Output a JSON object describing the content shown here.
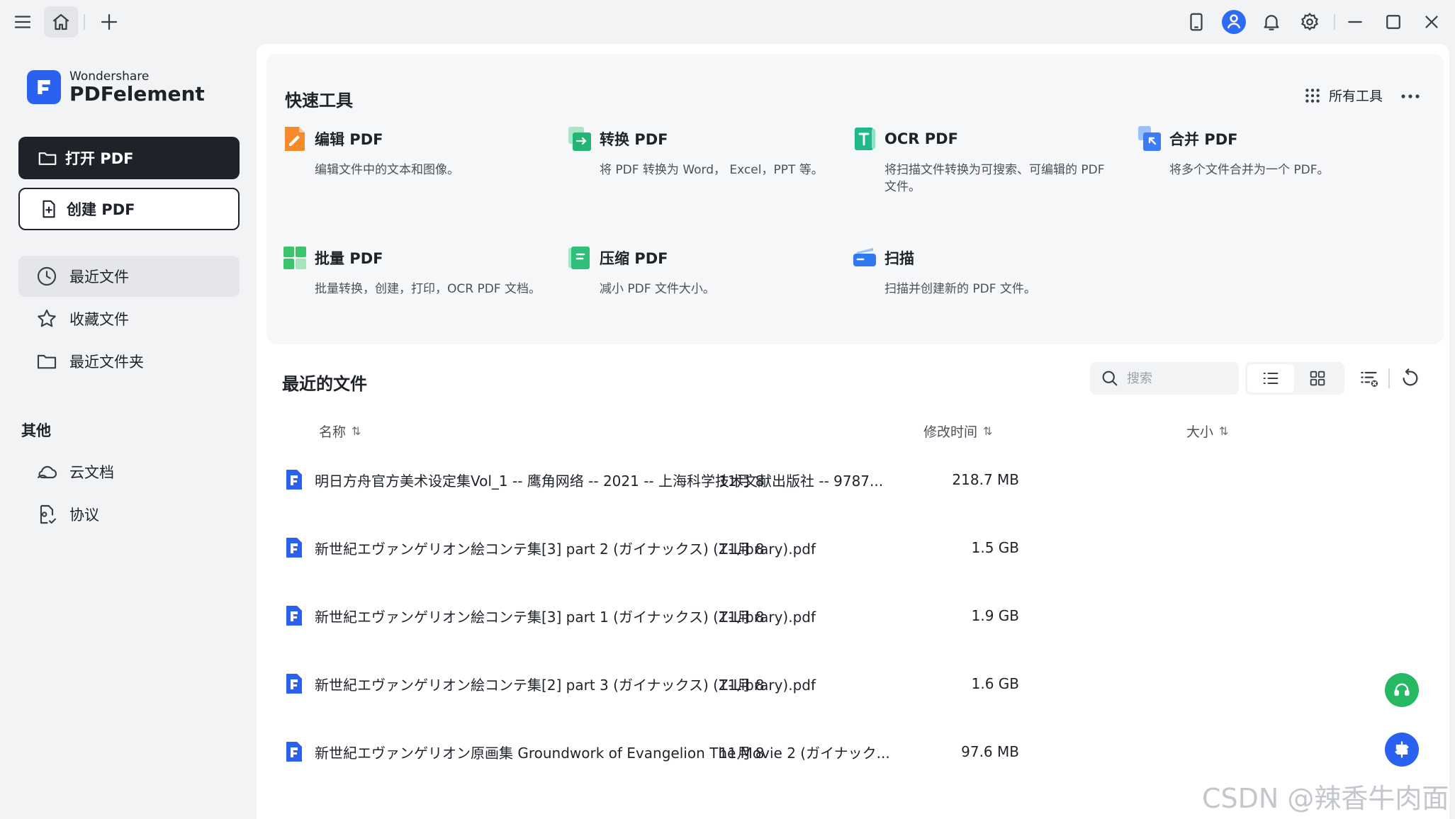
{
  "app": {
    "brand_small": "Wondershare",
    "brand_big": "PDFelement",
    "accent": "#2a61f0"
  },
  "titlebar": {
    "icons": [
      "menu-icon",
      "home-icon",
      "plus-icon",
      "tablet-icon",
      "user-icon",
      "bell-icon",
      "gear-icon",
      "minimize-icon",
      "maximize-icon",
      "close-icon"
    ]
  },
  "sidebar": {
    "open_label": "打开 PDF",
    "create_label": "创建 PDF",
    "nav": [
      {
        "label": "最近文件",
        "icon": "clock-icon",
        "active": true
      },
      {
        "label": "收藏文件",
        "icon": "star-icon",
        "active": false
      },
      {
        "label": "最近文件夹",
        "icon": "folder-icon",
        "active": false
      }
    ],
    "other_label": "其他",
    "other": [
      {
        "label": "云文档",
        "icon": "cloud-icon"
      },
      {
        "label": "协议",
        "icon": "agreement-icon"
      }
    ]
  },
  "quick_tools": {
    "title": "快速工具",
    "all_tools": "所有工具",
    "tools": [
      {
        "name": "编辑 PDF",
        "desc": "编辑文件中的文本和图像。",
        "color": "#f58a2a"
      },
      {
        "name": "转换 PDF",
        "desc": "将 PDF 转换为 Word， Excel，PPT 等。",
        "color": "#22b573"
      },
      {
        "name": "OCR PDF",
        "desc": "将扫描文件转换为可搜索、可编辑的 PDF 文件。",
        "color": "#1fb88a"
      },
      {
        "name": "合并 PDF",
        "desc": "将多个文件合并为一个 PDF。",
        "color": "#3b7cf5"
      },
      {
        "name": "批量 PDF",
        "desc": "批量转换，创建，打印，OCR PDF 文档。",
        "color": "#3cc36b"
      },
      {
        "name": "压缩 PDF",
        "desc": "减小 PDF 文件大小。",
        "color": "#2fbf7a"
      },
      {
        "name": "扫描",
        "desc": "扫描并创建新的 PDF 文件。",
        "color": "#2f78f0"
      }
    ]
  },
  "recent": {
    "title": "最近的文件",
    "search_placeholder": "搜索",
    "columns": {
      "name": "名称",
      "modified": "修改时间",
      "size": "大小",
      "sort_glyph": "⇅"
    },
    "files": [
      {
        "name": "明日方舟官方美术设定集Vol_1 -- 鹰角网络 -- 2021 -- 上海科学技术文献出版社 -- 9787...",
        "date": "11月 8",
        "size": "218.7 MB"
      },
      {
        "name": "新世紀エヴァンゲリオン絵コンテ集[3] part 2 (ガイナックス) (Z-Library).pdf",
        "date": "11月 8",
        "size": "1.5 GB"
      },
      {
        "name": "新世紀エヴァンゲリオン絵コンテ集[3] part 1 (ガイナックス) (Z-Library).pdf",
        "date": "11月 8",
        "size": "1.9 GB"
      },
      {
        "name": "新世紀エヴァンゲリオン絵コンテ集[2] part 3 (ガイナックス) (Z-Library).pdf",
        "date": "11月 8",
        "size": "1.6 GB"
      },
      {
        "name": "新世紀エヴァンゲリオン原画集 Groundwork of Evangelion The Movie 2 (ガイナック...",
        "date": "11月 8",
        "size": "97.6 MB"
      }
    ]
  },
  "watermark": "CSDN @辣香牛肉面"
}
